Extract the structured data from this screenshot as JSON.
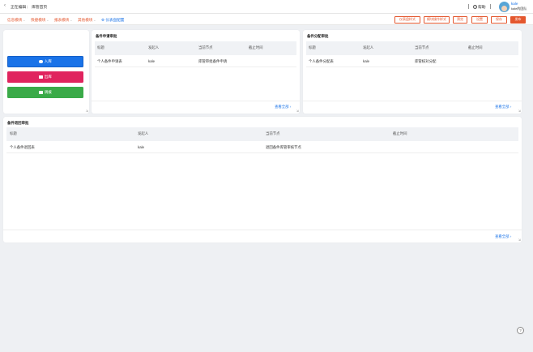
{
  "header": {
    "back_icon": "chevron-left-icon",
    "editing_label": "正在编辑：",
    "page_name": "库管首页",
    "help_label": "帮助",
    "user_name": "kale",
    "user_org": "kale的团队"
  },
  "toolbar": {
    "menus": [
      {
        "label": "信息模块",
        "color": "#e4572e"
      },
      {
        "label": "快捷模块",
        "color": "#e4572e"
      },
      {
        "label": "报表模块",
        "color": "#e4572e"
      },
      {
        "label": "其他模块",
        "color": "#e4572e"
      }
    ],
    "dashboard_config_label": "仪表盘配置",
    "buttons": [
      "仪表盘样式",
      "模块操作样式",
      "预览",
      "设置",
      "保存",
      "发布"
    ]
  },
  "actions": {
    "inbound_label": "入库",
    "outbound_label": "出库",
    "transfer_label": "调拨",
    "colors": {
      "inbound": "#1a73e8",
      "outbound": "#e0245e",
      "transfer": "#3aaa48"
    }
  },
  "tables": {
    "review": {
      "title": "备件申请审批",
      "columns": [
        "标题",
        "发起人",
        "当前节点",
        "截止时间"
      ],
      "rows": [
        [
          "个人备件申请表",
          "kale",
          "库管审批备件申请",
          ""
        ]
      ],
      "view_all": "查看全部"
    },
    "allocation": {
      "title": "备件分配审批",
      "columns": [
        "标题",
        "发起人",
        "当前节点",
        "截止时间"
      ],
      "rows": [
        [
          "个人备件分配表",
          "kale",
          "库管核对分配",
          ""
        ]
      ],
      "view_all": "查看全部"
    },
    "return": {
      "title": "备件退回审批",
      "columns": [
        "标题",
        "发起人",
        "当前节点",
        "截止时间"
      ],
      "rows": [
        [
          "个人备件退回表",
          "kale",
          "退回备件库管审核节点",
          ""
        ]
      ],
      "view_all": "查看全部"
    }
  },
  "accent": "#e4572e",
  "link_color": "#1a73e8"
}
